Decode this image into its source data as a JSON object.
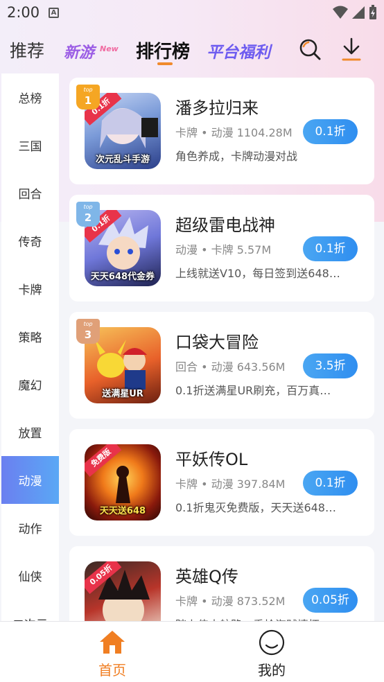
{
  "status_bar": {
    "time": "2:00",
    "notification_icon": "A"
  },
  "header": {
    "tabs": [
      {
        "label": "推荐"
      },
      {
        "label": "新游",
        "sub": "New"
      },
      {
        "label": "排行榜"
      },
      {
        "label": "平台福利"
      }
    ],
    "accent_color": "#f08a2c"
  },
  "sidebar": {
    "items": [
      {
        "label": "总榜"
      },
      {
        "label": "三国"
      },
      {
        "label": "回合"
      },
      {
        "label": "传奇"
      },
      {
        "label": "卡牌"
      },
      {
        "label": "策略"
      },
      {
        "label": "魔幻"
      },
      {
        "label": "放置"
      },
      {
        "label": "动漫"
      },
      {
        "label": "动作"
      },
      {
        "label": "仙侠"
      },
      {
        "label": "二次元"
      }
    ],
    "active_index": 8,
    "active_color": "#5a8ff2"
  },
  "games": [
    {
      "rank_top": "top",
      "rank_num": "1",
      "name": "潘多拉归来",
      "meta": "卡牌 • 动漫  1104.28M",
      "desc": "角色养成，卡牌动漫对战",
      "discount": "0.1折",
      "thumb_text": "次元乱斗手游",
      "thumb_tag": "0.1折"
    },
    {
      "rank_top": "top",
      "rank_num": "2",
      "name": "超级雷电战神",
      "meta": "动漫 • 卡牌  5.57M",
      "desc": "上线就送V10，每日签到送648…",
      "discount": "0.1折",
      "thumb_text": "天天648代金券",
      "thumb_tag": "0.1折"
    },
    {
      "rank_top": "top",
      "rank_num": "3",
      "name": "口袋大冒险",
      "meta": "回合 • 动漫  643.56M",
      "desc": "0.1折送满星UR刷充，百万真…",
      "discount": "3.5折",
      "thumb_text": "送满星UR",
      "thumb_tag": ""
    },
    {
      "rank_top": "",
      "rank_num": "",
      "name": "平妖传OL",
      "meta": "卡牌 • 动漫  397.84M",
      "desc": "0.1折鬼灭免费版，天天送648…",
      "discount": "0.1折",
      "thumb_text": "天天送648",
      "thumb_tag": "免费版"
    },
    {
      "rank_top": "",
      "rank_num": "",
      "name": "英雄Q传",
      "meta": "卡牌 • 动漫  873.52M",
      "desc": "踏上伟大航路，重拾海贼情怀",
      "discount": "0.05折",
      "thumb_text": "",
      "thumb_tag": "0.05折"
    }
  ],
  "bottom_nav": {
    "items": [
      {
        "label": "首页",
        "icon": "home-icon"
      },
      {
        "label": "我的",
        "icon": "profile-icon"
      }
    ],
    "active_color": "#f07e22"
  }
}
